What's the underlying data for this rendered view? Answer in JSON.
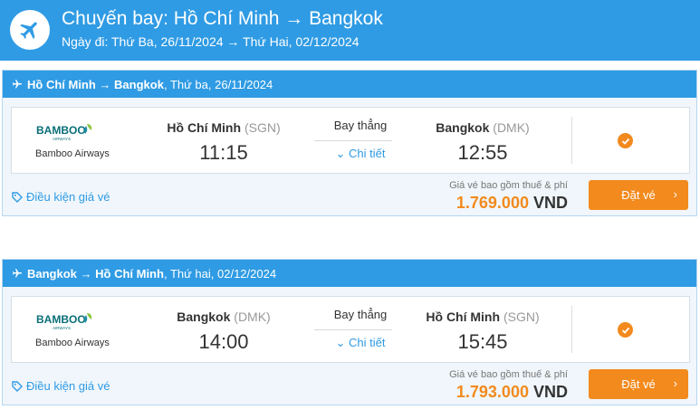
{
  "header": {
    "title": "Chuyến bay: Hồ Chí Minh → Bangkok",
    "dates": "Ngày đi: Thứ Ba, 26/11/2024 → Thứ Hai, 02/12/2024"
  },
  "flights": [
    {
      "route": "Hồ Chí Minh → Bangkok",
      "date": ", Thứ ba, 26/11/2024",
      "logo_text": "BAMBOO",
      "logo_sub": "AIRWAYS",
      "airline": "Bamboo Airways",
      "from_city": "Hồ Chí Minh",
      "from_code": "(SGN)",
      "depart_time": "11:15",
      "direct": "Bay thẳng",
      "detail": "Chi tiết",
      "to_city": "Bangkok",
      "to_code": "(DMK)",
      "arrive_time": "12:55",
      "fare_conditions": "Điều kiện giá vé",
      "price_note": "Giá vé bao gồm thuế & phí",
      "price": "1.769.000",
      "currency": "VND",
      "book": "Đặt vé"
    },
    {
      "route": "Bangkok → Hồ Chí Minh",
      "date": ", Thứ hai, 02/12/2024",
      "logo_text": "BAMBOO",
      "logo_sub": "AIRWAYS",
      "airline": "Bamboo Airways",
      "from_city": "Bangkok",
      "from_code": "(DMK)",
      "depart_time": "14:00",
      "direct": "Bay thẳng",
      "detail": "Chi tiết",
      "to_city": "Hồ Chí Minh",
      "to_code": "(SGN)",
      "arrive_time": "15:45",
      "fare_conditions": "Điều kiện giá vé",
      "price_note": "Giá vé bao gồm thuế & phí",
      "price": "1.793.000",
      "currency": "VND",
      "book": "Đặt vé"
    }
  ],
  "colors": {
    "primary": "#2f9be4",
    "accent": "#f28a1d",
    "logo": "#0a6f79"
  }
}
